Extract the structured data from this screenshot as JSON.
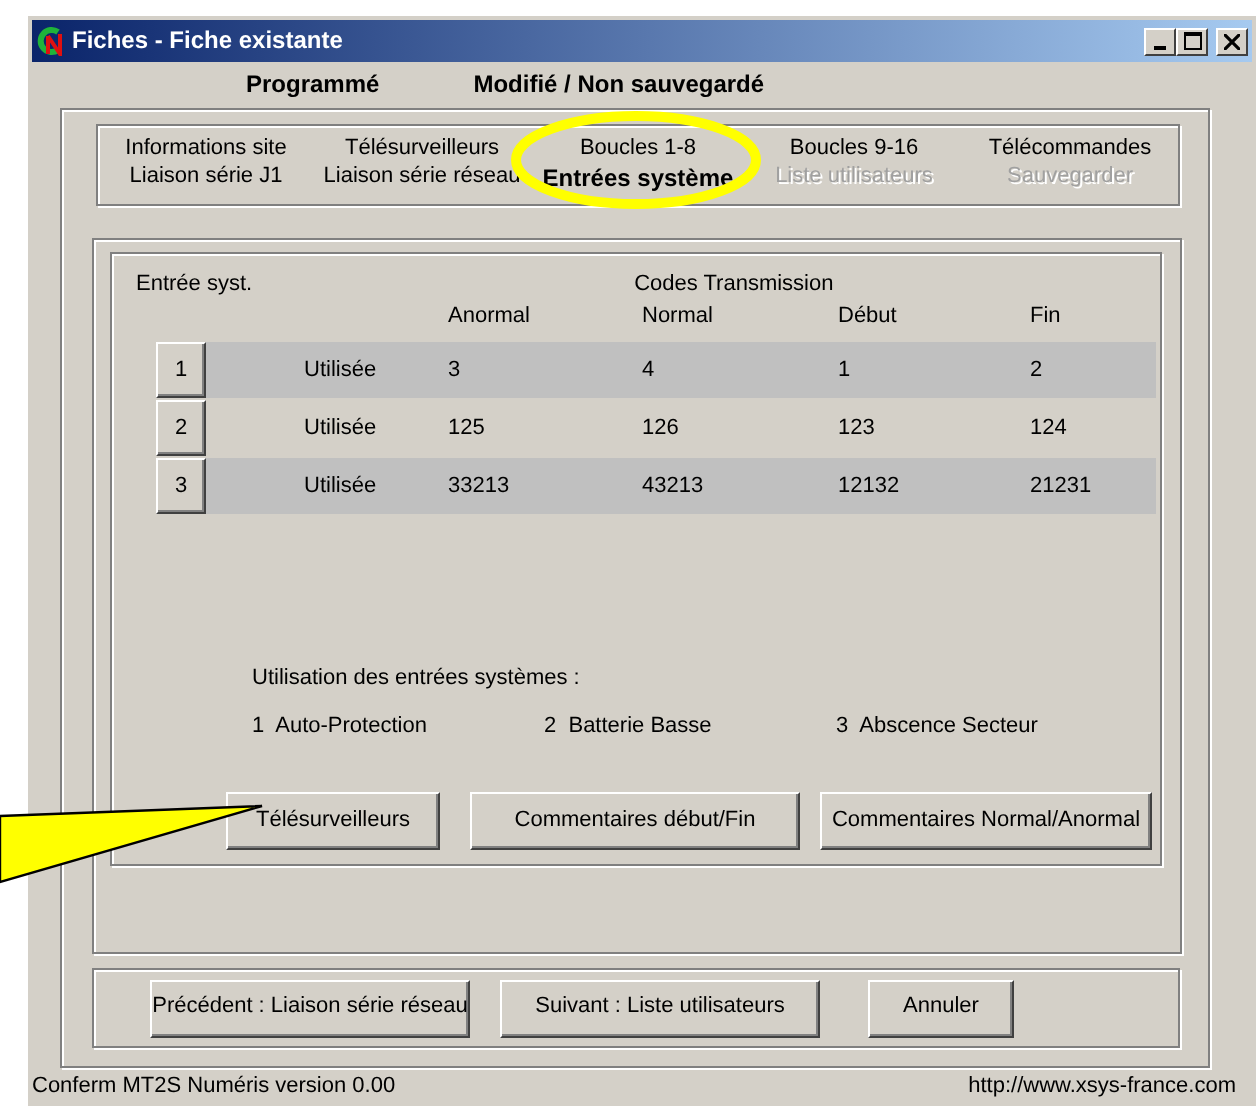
{
  "window": {
    "title": "Fiches - Fiche existante"
  },
  "status_flags": [
    "Programmé",
    "Modifié / Non sauvegardé"
  ],
  "tabs": [
    {
      "label": "Informations site",
      "selected": false,
      "disabled": false
    },
    {
      "label": "Télésurveilleurs",
      "selected": false,
      "disabled": false
    },
    {
      "label": "Boucles 1-8",
      "selected": false,
      "disabled": false
    },
    {
      "label": "Boucles 9-16",
      "selected": false,
      "disabled": false
    },
    {
      "label": "Télécommandes",
      "selected": false,
      "disabled": false
    },
    {
      "label": "Liaison série J1",
      "selected": false,
      "disabled": false
    },
    {
      "label": "Liaison série réseau",
      "selected": false,
      "disabled": false
    },
    {
      "label": "Entrées système",
      "selected": true,
      "disabled": false
    },
    {
      "label": "Liste utilisateurs",
      "selected": false,
      "disabled": true
    },
    {
      "label": "Sauvegarder",
      "selected": false,
      "disabled": true
    }
  ],
  "table": {
    "label": "Entrée syst.",
    "group_heading": "Codes Transmission",
    "columns": [
      "Anormal",
      "Normal",
      "Début",
      "Fin"
    ],
    "rows": [
      {
        "button": "1",
        "status": "Utilisée",
        "cells": [
          "3",
          "4",
          "1",
          "2"
        ]
      },
      {
        "button": "2",
        "status": "Utilisée",
        "cells": [
          "125",
          "126",
          "123",
          "124"
        ]
      },
      {
        "button": "3",
        "status": "Utilisée",
        "cells": [
          "33213",
          "43213",
          "12132",
          "21231"
        ]
      }
    ]
  },
  "legend": {
    "title": "Utilisation des entrées systèmes :",
    "items": [
      {
        "number": "1",
        "label": "Auto-Protection"
      },
      {
        "number": "2",
        "label": "Batterie Basse"
      },
      {
        "number": "3",
        "label": "Abscence Secteur"
      }
    ]
  },
  "action_buttons": [
    "Télésurveilleurs",
    "Commentaires début/Fin",
    "Commentaires Normal/Anormal"
  ],
  "nav_buttons": [
    "Précédent : Liaison série réseau",
    "Suivant : Liste utilisateurs",
    "Annuler"
  ],
  "status_bar": {
    "left": "Conferm MT2S Numéris version 0.00",
    "right": "http://www.xsys-france.com"
  }
}
